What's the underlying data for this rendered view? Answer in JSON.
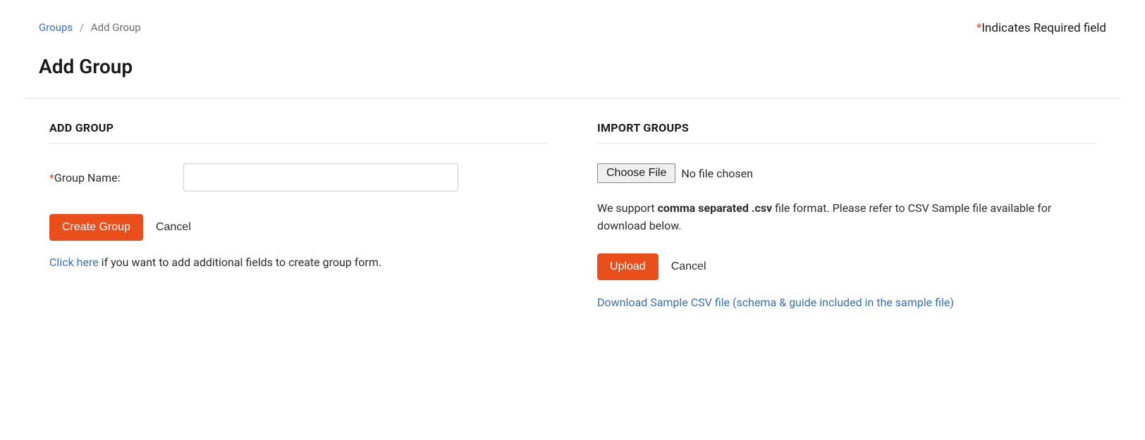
{
  "breadcrumb": {
    "root": "Groups",
    "separator": "/",
    "current": "Add Group"
  },
  "required_note": {
    "asterisk": "*",
    "text": "Indicates Required field"
  },
  "page_title": "Add Group",
  "left": {
    "heading": "ADD GROUP",
    "field": {
      "asterisk": "*",
      "label": "Group Name:"
    },
    "buttons": {
      "create": "Create Group",
      "cancel": "Cancel"
    },
    "helper": {
      "link": "Click here",
      "rest": " if you want to add additional fields to create group form."
    }
  },
  "right": {
    "heading": "IMPORT GROUPS",
    "file": {
      "choose": "Choose File",
      "status": "No file chosen"
    },
    "support": {
      "pre": "We support ",
      "bold": "comma separated .csv",
      "post": " file format. Please refer to CSV Sample file available for download below."
    },
    "buttons": {
      "upload": "Upload",
      "cancel": "Cancel"
    },
    "download_link": "Download Sample CSV file (schema & guide included in the sample file)"
  }
}
